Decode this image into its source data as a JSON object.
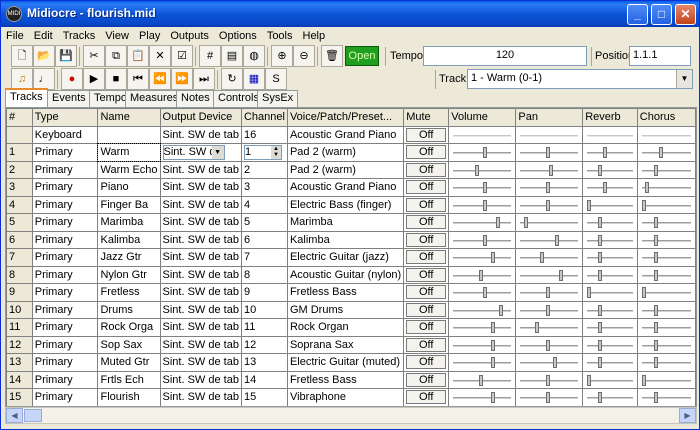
{
  "window": {
    "title": "Midiocre - flourish.mid",
    "app_icon_text": "MIDI"
  },
  "titlebar_buttons": {
    "minimize": "_",
    "maximize": "□",
    "close": "✕"
  },
  "menu": [
    "File",
    "Edit",
    "Tracks",
    "View",
    "Play",
    "Outputs",
    "Options",
    "Tools",
    "Help"
  ],
  "toolbar": {
    "open_label": "Open",
    "tempo_label": "Tempo",
    "tempo_value": "120",
    "position_label": "Position",
    "position_value": "1.1.1",
    "track_label": "Track",
    "track_value": "1 - Warm (0-1)"
  },
  "tabs": [
    "Tracks",
    "Events",
    "Tempo",
    "Measures",
    "Notes",
    "Controls",
    "SysEx"
  ],
  "grid": {
    "headers": [
      "#",
      "Type",
      "Name",
      "Output Device",
      "Channel",
      "Voice/Patch/Preset...",
      "Mute",
      "Volume",
      "Pan",
      "Reverb",
      "Chorus"
    ],
    "mute_label": "Off",
    "editing_row": {
      "device": "Sint. SW d",
      "channel": "1"
    },
    "rows": [
      {
        "num": "",
        "type": "Keyboard",
        "name": "",
        "device": "Sint. SW de tab",
        "channel": "16",
        "voice": "Acoustic Grand Piano",
        "volume": null,
        "pan": null,
        "reverb": null,
        "chorus": null
      },
      {
        "num": "1",
        "type": "Primary",
        "name": "Warm",
        "device": "",
        "channel": "",
        "voice": "Pad 2 (warm)",
        "volume": 0.56,
        "pan": 0.5,
        "reverb": 0.4,
        "chorus": 0.4
      },
      {
        "num": "2",
        "type": "Primary",
        "name": "Warm Echo",
        "device": "Sint. SW de tab",
        "channel": "2",
        "voice": "Pad 2 (warm)",
        "volume": 0.42,
        "pan": 0.55,
        "reverb": 0.3,
        "chorus": 0.3
      },
      {
        "num": "3",
        "type": "Primary",
        "name": "Piano",
        "device": "Sint. SW de tab",
        "channel": "3",
        "voice": "Acoustic Grand Piano",
        "volume": 0.56,
        "pan": 0.5,
        "reverb": 0.4,
        "chorus": 0.1
      },
      {
        "num": "4",
        "type": "Primary",
        "name": "Finger Ba",
        "device": "Sint. SW de tab",
        "channel": "4",
        "voice": "Electric Bass (finger)",
        "volume": 0.56,
        "pan": 0.5,
        "reverb": 0.05,
        "chorus": 0.05
      },
      {
        "num": "5",
        "type": "Primary",
        "name": "Marimba",
        "device": "Sint. SW de tab",
        "channel": "5",
        "voice": "Marimba",
        "volume": 0.8,
        "pan": 0.1,
        "reverb": 0.3,
        "chorus": 0.3
      },
      {
        "num": "6",
        "type": "Primary",
        "name": "Kalimba",
        "device": "Sint. SW de tab",
        "channel": "6",
        "voice": "Kalimba",
        "volume": 0.56,
        "pan": 0.65,
        "reverb": 0.3,
        "chorus": 0.3
      },
      {
        "num": "7",
        "type": "Primary",
        "name": "Jazz Gtr",
        "device": "Sint. SW de tab",
        "channel": "7",
        "voice": "Electric Guitar (jazz)",
        "volume": 0.7,
        "pan": 0.38,
        "reverb": 0.3,
        "chorus": 0.3
      },
      {
        "num": "8",
        "type": "Primary",
        "name": "Nylon Gtr",
        "device": "Sint. SW de tab",
        "channel": "8",
        "voice": "Acoustic Guitar (nylon)",
        "volume": 0.5,
        "pan": 0.72,
        "reverb": 0.3,
        "chorus": 0.3
      },
      {
        "num": "9",
        "type": "Primary",
        "name": "Fretless",
        "device": "Sint. SW de tab",
        "channel": "9",
        "voice": "Fretless Bass",
        "volume": 0.56,
        "pan": 0.5,
        "reverb": 0.05,
        "chorus": 0.05
      },
      {
        "num": "10",
        "type": "Primary",
        "name": "Drums",
        "device": "Sint. SW de tab",
        "channel": "10",
        "voice": "GM Drums",
        "volume": 0.85,
        "pan": 0.5,
        "reverb": 0.3,
        "chorus": 0.3
      },
      {
        "num": "11",
        "type": "Primary",
        "name": "Rock Orga",
        "device": "Sint. SW de tab",
        "channel": "11",
        "voice": "Rock Organ",
        "volume": 0.7,
        "pan": 0.3,
        "reverb": 0.3,
        "chorus": 0.3
      },
      {
        "num": "12",
        "type": "Primary",
        "name": "Sop Sax",
        "device": "Sint. SW de tab",
        "channel": "12",
        "voice": "Soprana Sax",
        "volume": 0.7,
        "pan": 0.5,
        "reverb": 0.3,
        "chorus": 0.3
      },
      {
        "num": "13",
        "type": "Primary",
        "name": "Muted Gtr",
        "device": "Sint. SW de tab",
        "channel": "13",
        "voice": "Electric Guitar (muted)",
        "volume": 0.7,
        "pan": 0.62,
        "reverb": 0.3,
        "chorus": 0.3
      },
      {
        "num": "14",
        "type": "Primary",
        "name": "Frtls Ech",
        "device": "Sint. SW de tab",
        "channel": "14",
        "voice": "Fretless Bass",
        "volume": 0.5,
        "pan": 0.5,
        "reverb": 0.05,
        "chorus": 0.05
      },
      {
        "num": "15",
        "type": "Primary",
        "name": "Flourish",
        "device": "Sint. SW de tab",
        "channel": "15",
        "voice": "Vibraphone",
        "volume": 0.7,
        "pan": 0.5,
        "reverb": 0.3,
        "chorus": 0.3
      }
    ]
  }
}
